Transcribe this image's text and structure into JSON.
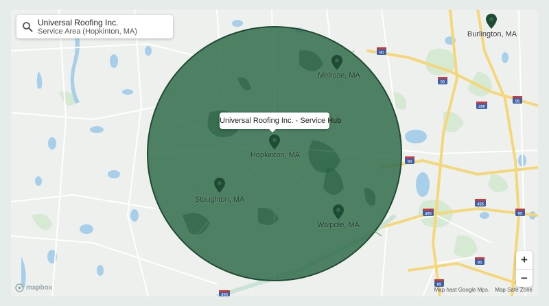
{
  "search": {
    "title": "Universal Roofing Inc.",
    "subtitle": "Service Area (Hopkinton, MA)"
  },
  "popup": {
    "text": "Universal Roofing Inc. - Service Hub"
  },
  "cities": {
    "burlington": "Burlington, MA",
    "melrose": "Melrose, MA",
    "hopkinton": "Hopkinton, MA",
    "stoughton": "Stoughton, MA",
    "walpole": "Walpole, MA"
  },
  "highway_shields": [
    "90",
    "90",
    "495",
    "95",
    "90",
    "495",
    "495",
    "95",
    "95",
    "495",
    "95"
  ],
  "zoom": {
    "in": "+",
    "out": "−"
  },
  "logo": {
    "text": "mapbox"
  },
  "attribution": {
    "left": "Map hast Google Mps.",
    "right": "Map Safe Zone"
  },
  "colors": {
    "service_area_fill": "#2f6a49",
    "service_area_border": "#1f4a33",
    "pin": "#1f4a33",
    "water": "#a8cfe9",
    "park": "#cfe6cc",
    "highway": "#f4d77a"
  }
}
